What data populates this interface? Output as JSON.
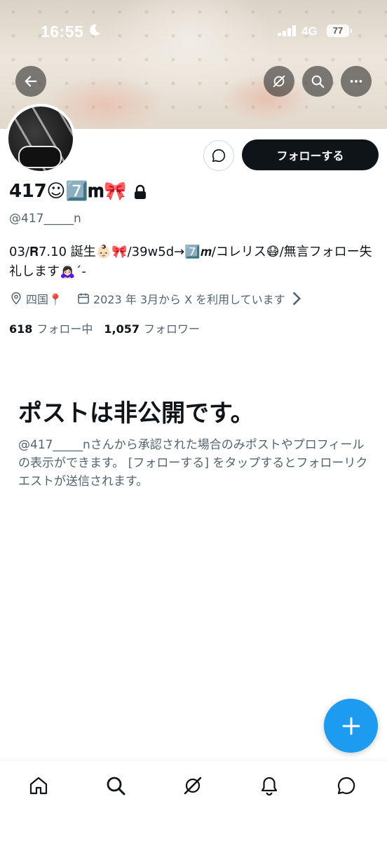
{
  "status_bar": {
    "time": "16:55",
    "network": "4G",
    "battery": "77"
  },
  "header": {
    "back_icon": "arrow-left-icon",
    "grok_icon": "grok-icon",
    "search_icon": "search-icon",
    "more_icon": "more-icon"
  },
  "profile": {
    "display_name": "417☺︎7️⃣𝐦🎀",
    "handle": "@417_____n",
    "bio": "03/𝐑7.10 誕生👶🏻🎀/39w5d→7️⃣𝒎/コレリス😷/無言フォロー失礼します🙇🏻‍♀️´-",
    "location": "四国📍",
    "joined": "2023 年 3月から X を利用しています",
    "following_count": "618",
    "following_label": "フォロー中",
    "followers_count": "1,057",
    "followers_label": "フォロワー"
  },
  "actions": {
    "follow_label": "フォローする"
  },
  "private_notice": {
    "title": "ポストは非公開です。",
    "description": "@417_____nさんから承認された場合のみポストやプロフィールの表示ができます。 [フォローする] をタップするとフォローリクエストが送信されます。"
  },
  "bottom_nav": [
    "home-icon",
    "search-icon",
    "grok-icon",
    "notifications-icon",
    "messages-icon"
  ],
  "colors": {
    "accent": "#1d9bf0",
    "text": "#0f1419",
    "secondary_text": "#536471",
    "follow_button": "#0f1419"
  }
}
